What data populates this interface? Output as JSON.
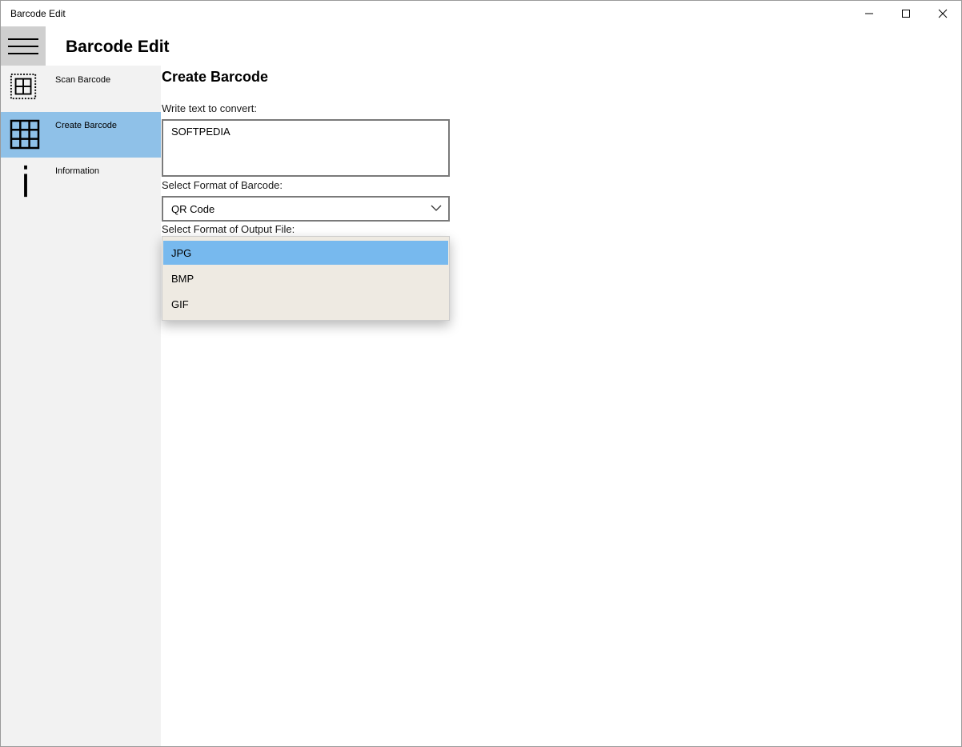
{
  "window": {
    "title": "Barcode Edit"
  },
  "window_controls": [
    "minimize",
    "maximize",
    "close"
  ],
  "app": {
    "title": "Barcode Edit"
  },
  "nav": {
    "items": [
      {
        "label": "Scan Barcode",
        "icon": "scan-barcode-icon",
        "selected": false
      },
      {
        "label": "Create Barcode",
        "icon": "grid-icon",
        "selected": true
      },
      {
        "label": "Information",
        "icon": "info-icon",
        "selected": false
      }
    ]
  },
  "main": {
    "heading": "Create Barcode",
    "text_label": "Write text to convert:",
    "text_value": "SOFTPEDIA",
    "barcode_format_label": "Select Format of Barcode:",
    "barcode_format_value": "QR Code",
    "output_format_label": "Select Format of Output File:",
    "output_options": [
      {
        "label": "JPG",
        "selected": true
      },
      {
        "label": "BMP",
        "selected": false
      },
      {
        "label": "GIF",
        "selected": false
      }
    ]
  },
  "colors": {
    "nav_selected": "#8fc1e8",
    "dropdown_selected": "#77b9ee",
    "nav_background": "#f2f2f2",
    "hamburger_background": "#cfcfcf",
    "dropdown_background": "#eeeae2"
  }
}
